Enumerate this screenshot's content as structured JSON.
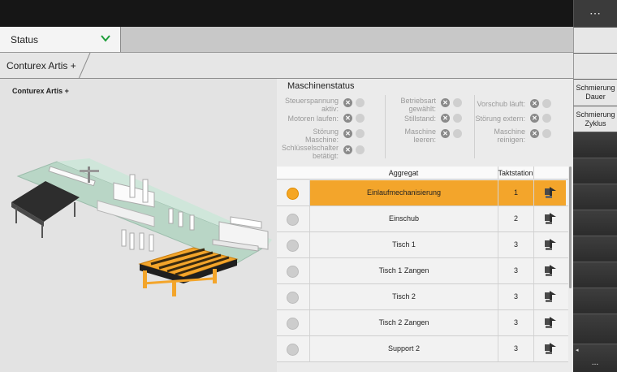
{
  "header": {
    "menu_label": "⋯"
  },
  "status": {
    "selected": "Status"
  },
  "breadcrumb": {
    "label": "Conturex Artis +"
  },
  "view": {
    "title": "Conturex Artis +"
  },
  "machine_status": {
    "title": "Maschinenstatus",
    "items": [
      {
        "label": "Steuerspannung aktiv:",
        "col": 0
      },
      {
        "label": "Motoren laufen:",
        "col": 0
      },
      {
        "label": "Störung Maschine:",
        "col": 0
      },
      {
        "label": "Schlüsselschalter betätigt:",
        "col": 0
      },
      {
        "label": "Betriebsart gewählt:",
        "col": 1
      },
      {
        "label": "Stillstand:",
        "col": 1
      },
      {
        "label": "Maschine leeren:",
        "col": 1
      },
      {
        "label": "Vorschub läuft:",
        "col": 2
      },
      {
        "label": "Störung extern:",
        "col": 2
      },
      {
        "label": "Maschine reinigen:",
        "col": 2
      }
    ]
  },
  "table": {
    "headers": {
      "aggregat": "Aggregat",
      "taktstation": "Taktstation"
    },
    "rows": [
      {
        "name": "Einlaufmechanisierung",
        "takt": "1",
        "active": true
      },
      {
        "name": "Einschub",
        "takt": "2",
        "active": false
      },
      {
        "name": "Tisch 1",
        "takt": "3",
        "active": false
      },
      {
        "name": "Tisch 1 Zangen",
        "takt": "3",
        "active": false
      },
      {
        "name": "Tisch 2",
        "takt": "3",
        "active": false
      },
      {
        "name": "Tisch 2 Zangen",
        "takt": "3",
        "active": false
      },
      {
        "name": "Support 2",
        "takt": "3",
        "active": false
      }
    ]
  },
  "side_buttons": {
    "btn1": "",
    "btn2": "",
    "btn3_line1": "Schmierung",
    "btn3_line2": "Dauer",
    "btn4_line1": "Schmierung",
    "btn4_line2": "Zyklus",
    "more": "...",
    "more_arrow": "◂"
  },
  "colors": {
    "accent": "#f3a52b",
    "chevron": "#1e9e3a"
  },
  "icons": {
    "status_chevron": "chevron-down-icon",
    "row_action": "machine-action-icon",
    "error_state": "x-circle-icon"
  }
}
